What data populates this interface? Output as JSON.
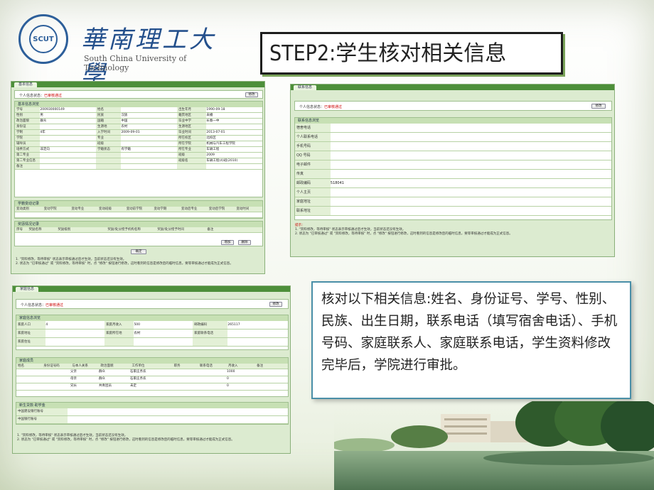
{
  "header": {
    "university_cn": "華南理工大學",
    "university_en": "South China University of Technology",
    "seal_text": "SCUT"
  },
  "step_title": "STEP2:学生核对相关信息",
  "info_text": "核对以下相关信息:姓名、身份证号、学号、性别、民族、出生日期，联系电话（填写宿舍电话）、手机号码、家庭联系人、家庭联系电话，学生资料修改完毕后，学院进行审批。",
  "shot1": {
    "tab": "基本信息",
    "status_label": "个人信息状态：",
    "status_value": "已审核通过",
    "modify_button": "修改",
    "basic_panel": "基本信息浏览",
    "rows": [
      [
        "学号",
        "200930000149",
        "姓名",
        "",
        "出生年月",
        "1990-09-18"
      ],
      [
        "性别",
        "男",
        "民族",
        "汉族",
        "籍贯地区",
        "未播"
      ],
      [
        "政治面貌",
        "群众",
        "国籍",
        "中国",
        "毕业中学",
        "长春一中"
      ],
      [
        "身份证",
        "",
        "生源地",
        "农村",
        "生源地区",
        ""
      ],
      [
        "学制",
        "4年",
        "入学时间",
        "2009-09-01",
        "毕业时间",
        "2013-07-01"
      ],
      [
        "学院",
        "",
        "专业",
        "",
        "所在校区",
        "北校区"
      ],
      [
        "辅导员",
        "",
        "班级",
        "",
        "所在学院",
        "机械与汽车工程学院"
      ],
      [
        "培养方式",
        "非定向",
        "学籍状态",
        "有学籍",
        "所在专业",
        "车辆工程"
      ],
      [
        "第二专业",
        "",
        "",
        "",
        "班级",
        "2009"
      ],
      [
        "第二专业信息",
        "",
        "",
        "",
        "班级名",
        "车辆工程(4)班(2010)"
      ],
      [
        "备注",
        "",
        "",
        "",
        "",
        ""
      ]
    ],
    "study_panel": "学籍变动记录",
    "study_cols": [
      "变动类别",
      "变动学院",
      "变动专业",
      "变动班级",
      "变动前学院",
      "变动学期",
      "变动后专业",
      "变动后学院",
      "变动时间"
    ],
    "award_panel": "奖惩情况记录",
    "award_cols": [
      "序号",
      "奖励名称",
      "奖励级别",
      "奖励/处分授予机构名称",
      "奖励/处分授予时间",
      "备注"
    ],
    "add_button": "增加",
    "delete_button": "删除",
    "bottom_button": "确定",
    "notes": [
      "1. \"资料修改，等待审核\" 状态表示审核通过后才生效，当前状态还没有生效。",
      "2. 状态为 \"已审核通过\" 或 \"资料修改，等待审核\" 时，点 \"修改\" 按钮进行修改，这时看到的信息是修改后的临时信息，要等审核通过才能成为正式信息。"
    ]
  },
  "shot2": {
    "tab": "联系信息",
    "status_label": "个人信息状态：",
    "status_value": "已审核通过",
    "modify_button": "修改",
    "panel": "联系信息浏览",
    "rows": [
      {
        "label": "宿舍电话",
        "value": ""
      },
      {
        "label": "个人联系电话",
        "value": ""
      },
      {
        "label": "手机号码",
        "value": ""
      },
      {
        "label": "QQ 号码",
        "value": ""
      },
      {
        "label": "电子邮件",
        "value": ""
      },
      {
        "label": "传真",
        "value": ""
      },
      {
        "label": "邮政编码",
        "value": "518041"
      },
      {
        "label": "个人主页",
        "value": ""
      },
      {
        "label": "家庭地址",
        "value": ""
      },
      {
        "label": "联系地址",
        "value": ""
      }
    ],
    "notes_title": "提示：",
    "notes": [
      "1. \"资料修改，等待审核\" 状态表示审核通过后才生效，当前状态还没有生效。",
      "2. 状态为 \"已审核通过\" 或 \"资料修改，等待审核\" 时，点 \"修改\" 按钮进行修改，这时看到的信息是修改后的临时信息，要等审核通过才能成为正式信息。"
    ]
  },
  "shot3": {
    "tab": "家庭信息",
    "status_label": "个人信息状态：",
    "status_value": "已审核通过",
    "modify_button": "修改",
    "family_panel": "家庭信息浏览",
    "family_rows": [
      [
        "家庭人口",
        "4",
        "家庭月收入",
        "500",
        "邮政编码",
        "265117"
      ],
      [
        "家庭地址",
        "",
        "家庭所在地",
        "农村",
        "家庭联系电话",
        ""
      ],
      [
        "家庭住址",
        "",
        "",
        "",
        "",
        ""
      ]
    ],
    "members_panel": "家庭成员",
    "members_cols": [
      "姓名",
      "身份证号码",
      "与本人关系",
      "政治面貌",
      "工作单位",
      "职务",
      "联系电话",
      "月收入",
      "备注"
    ],
    "members_rows": [
      [
        "",
        "",
        "父亲",
        "群众",
        "石家庄务农",
        "",
        "",
        "1000",
        ""
      ],
      [
        "",
        "",
        "母亲",
        "群众",
        "石家庄务农",
        "",
        "",
        "0",
        ""
      ],
      [
        "",
        "",
        "兄长",
        "共青团员",
        "未定",
        "",
        "",
        "0",
        ""
      ]
    ],
    "bank_panel": "新生贷款·助学金",
    "bank_rows": [
      "中国建设银行账号",
      "中国银行账号"
    ],
    "notes": [
      "1. \"资料修改，等待审核\" 状态表示审核通过后才生效，当前状态还没有生效。",
      "2. 状态为 \"已审核通过\" 或 \"资料修改，等待审核\" 时，点 \"修改\" 按钮进行修改，这时看到的信息是修改后的临时信息，要等审核通过才能成为正式信息。"
    ]
  }
}
